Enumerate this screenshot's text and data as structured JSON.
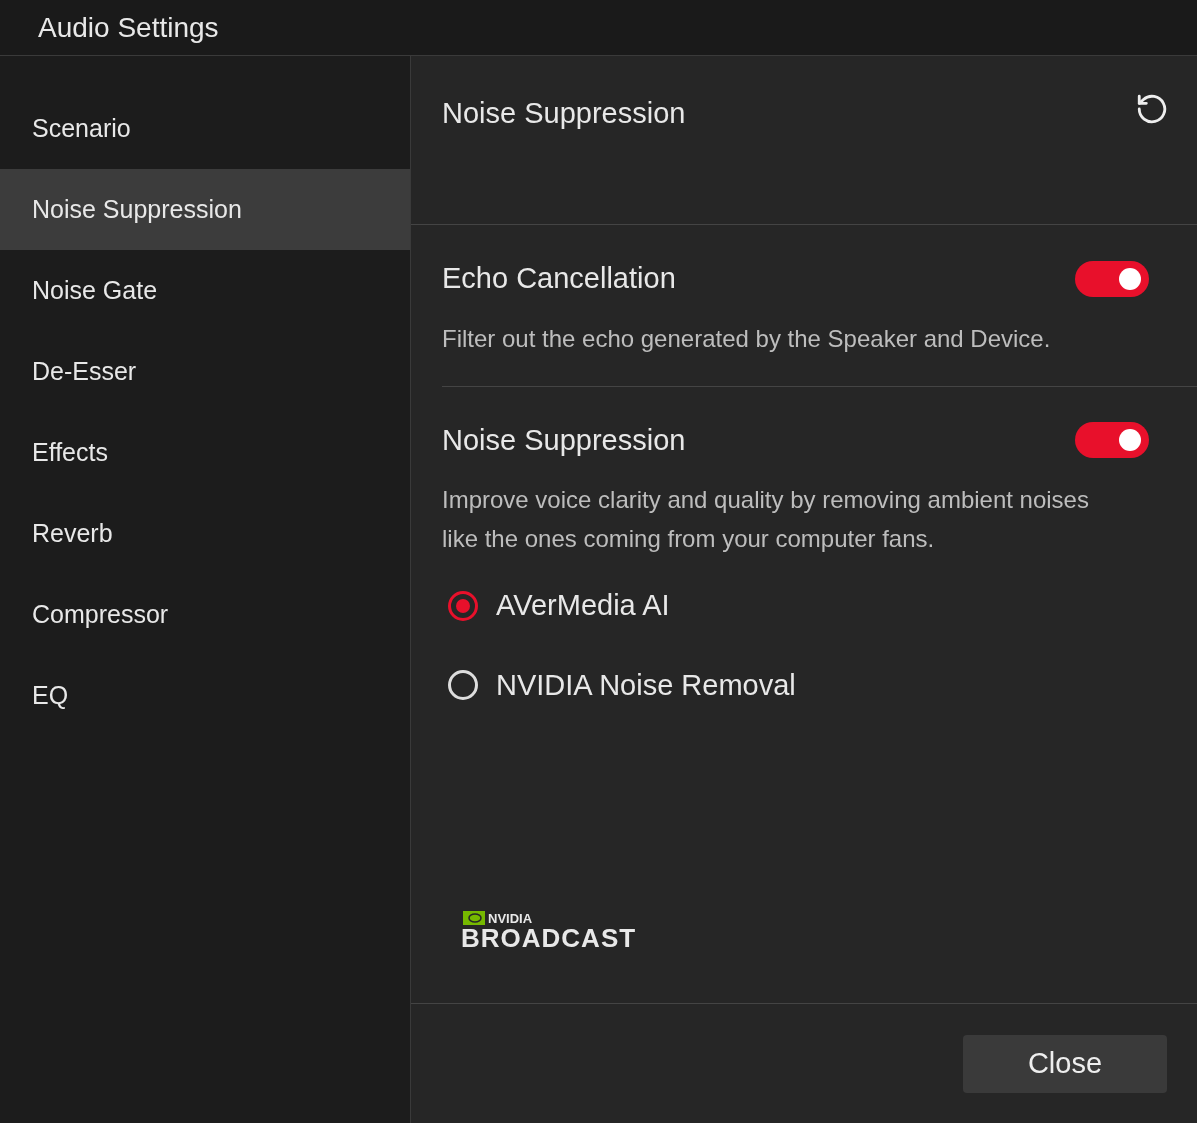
{
  "window": {
    "title": "Audio Settings"
  },
  "sidebar": {
    "items": [
      {
        "label": "Scenario",
        "selected": false
      },
      {
        "label": "Noise Suppression",
        "selected": true
      },
      {
        "label": "Noise Gate",
        "selected": false
      },
      {
        "label": "De-Esser",
        "selected": false
      },
      {
        "label": "Effects",
        "selected": false
      },
      {
        "label": "Reverb",
        "selected": false
      },
      {
        "label": "Compressor",
        "selected": false
      },
      {
        "label": "EQ",
        "selected": false
      }
    ]
  },
  "panel": {
    "title": "Noise Suppression",
    "sections": [
      {
        "title": "Echo Cancellation",
        "on": true,
        "description": "Filter out the echo generated by the Speaker and Device."
      },
      {
        "title": "Noise Suppression",
        "on": true,
        "description": "Improve voice clarity and quality by removing ambient noises like the ones coming from your computer fans.",
        "options": [
          {
            "label": "AVerMedia AI",
            "selected": true
          },
          {
            "label": "NVIDIA Noise Removal",
            "selected": false
          }
        ]
      }
    ],
    "logo": {
      "brand": "NVIDIA",
      "product": "BROADCAST"
    }
  },
  "buttons": [
    "Close"
  ]
}
